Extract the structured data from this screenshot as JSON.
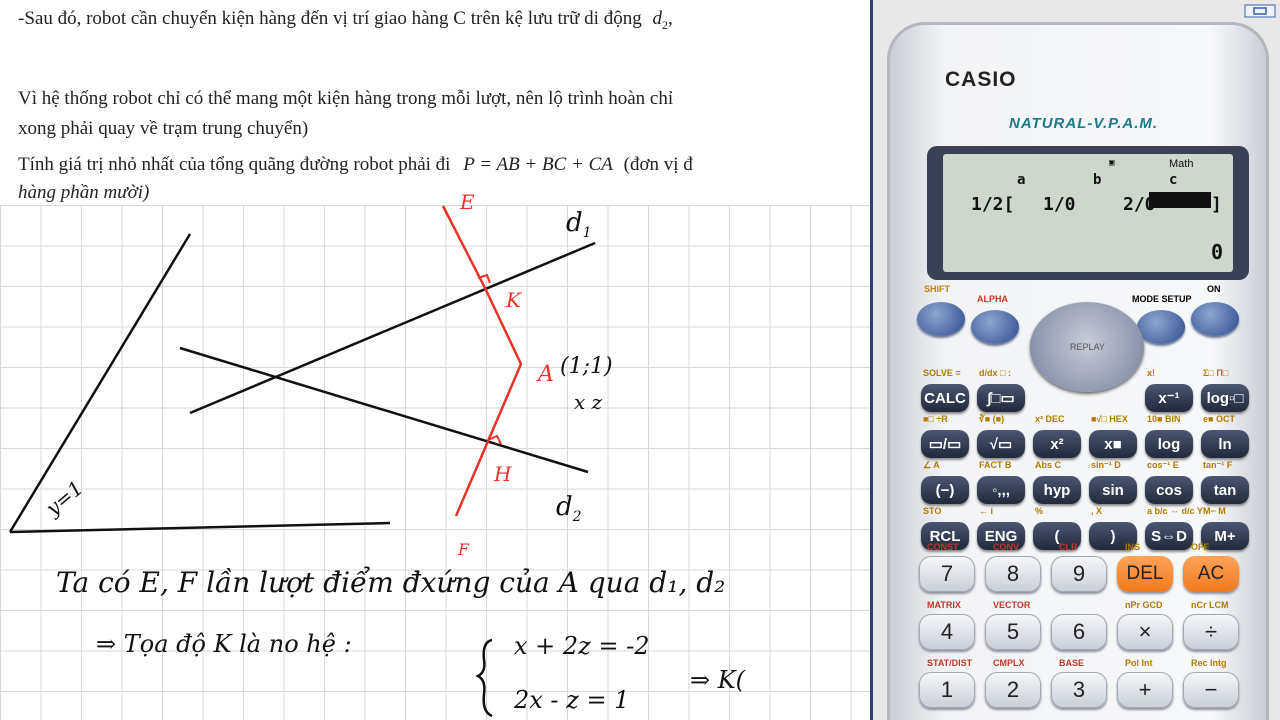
{
  "document": {
    "line1": "-Sau đó, robot cần chuyển kiện hàng đến vị trí giao hàng C trên kệ lưu trữ di động",
    "line1_var": "d",
    "line1_sub": "2",
    "line1_tail": ",",
    "line2": "Vì hệ thống robot chỉ có thể mang một kiện hàng trong mỗi lượt, nên lộ trình hoàn chỉ",
    "line3": "xong phải quay về trạm trung chuyển)",
    "line4_a": "Tính giá trị nhỏ nhất của tổng quãng đường robot phải đi",
    "line4_formula": "P = AB + BC + CA",
    "line4_b": "(đơn vị đ",
    "line5": "hàng phần mười)"
  },
  "drawing": {
    "label_E": "E",
    "label_K": "K",
    "label_A": "A",
    "label_A_coord": "(1;1)",
    "label_xz": "x z",
    "label_H": "H",
    "label_F": "F",
    "label_d1": "d",
    "label_d1_sub": "1",
    "label_d2": "d",
    "label_d2_sub": "2",
    "label_y1": "y=1",
    "note1": "Ta có E, F lần lượt điểm đxứng của A qua d₁, d₂",
    "note2": "⇒ Tọa độ K là no hệ :",
    "eq1": "x + 2z = -2",
    "eq2": "2x - z = 1",
    "note3": "⇒ K("
  },
  "calculator": {
    "brand": "CASIO",
    "model": "NATURAL-V.P.A.M.",
    "lcd": {
      "mode": "Math",
      "indicator": "▣",
      "col_a": "a",
      "col_b": "b",
      "col_c": "c",
      "row_frac": "1/2[",
      "cell1": "1/0",
      "cell2": "2/0",
      "cell3_end": "]",
      "result": "0"
    },
    "top_labels": {
      "shift": "SHIFT",
      "alpha": "ALPHA",
      "mode": "MODE SETUP",
      "on": "ON",
      "replay": "REPLAY"
    },
    "fn_rows": [
      {
        "keys": [
          "CALC",
          "∫□▭",
          "",
          "",
          "x⁻¹",
          "log▫□"
        ],
        "labels": [
          "SOLVE =",
          "d/dx □ :",
          "",
          "",
          "x!",
          "Σ□ Π□"
        ]
      },
      {
        "keys": [
          "▭/▭",
          "√▭",
          "x²",
          "x■",
          "log",
          "ln"
        ],
        "labels": [
          "■□ ÷R",
          "∛■ (■)",
          "x³ DEC",
          "■√□ HEX",
          "10■ BIN",
          "e■ OCT"
        ]
      },
      {
        "keys": [
          "(−)",
          "◦,,,",
          "hyp",
          "sin",
          "cos",
          "tan"
        ],
        "labels": [
          "∠ A",
          "FACT B",
          "Abs C",
          "sin⁻¹ D",
          "cos⁻¹ E",
          "tan⁻¹ F"
        ]
      },
      {
        "keys": [
          "RCL",
          "ENG",
          "(",
          ")",
          "S⇔D",
          "M+"
        ],
        "labels": [
          "STO",
          "← i",
          "%",
          ", X",
          "a b/c ⇔ d/c Y",
          "M− M"
        ]
      }
    ],
    "num_rows": [
      {
        "keys": [
          "7",
          "8",
          "9",
          "DEL",
          "AC"
        ],
        "labels": [
          "CONST",
          "CONV",
          "CLR",
          "INS",
          "OFF"
        ]
      },
      {
        "keys": [
          "4",
          "5",
          "6",
          "×",
          "÷"
        ],
        "labels": [
          "MATRIX",
          "VECTOR",
          "",
          "nPr GCD",
          "nCr LCM"
        ]
      },
      {
        "keys": [
          "1",
          "2",
          "3",
          "+",
          "−"
        ],
        "labels": [
          "STAT/DIST",
          "CMPLX",
          "BASE",
          "Pol Int",
          "Rec Intg"
        ]
      }
    ]
  }
}
